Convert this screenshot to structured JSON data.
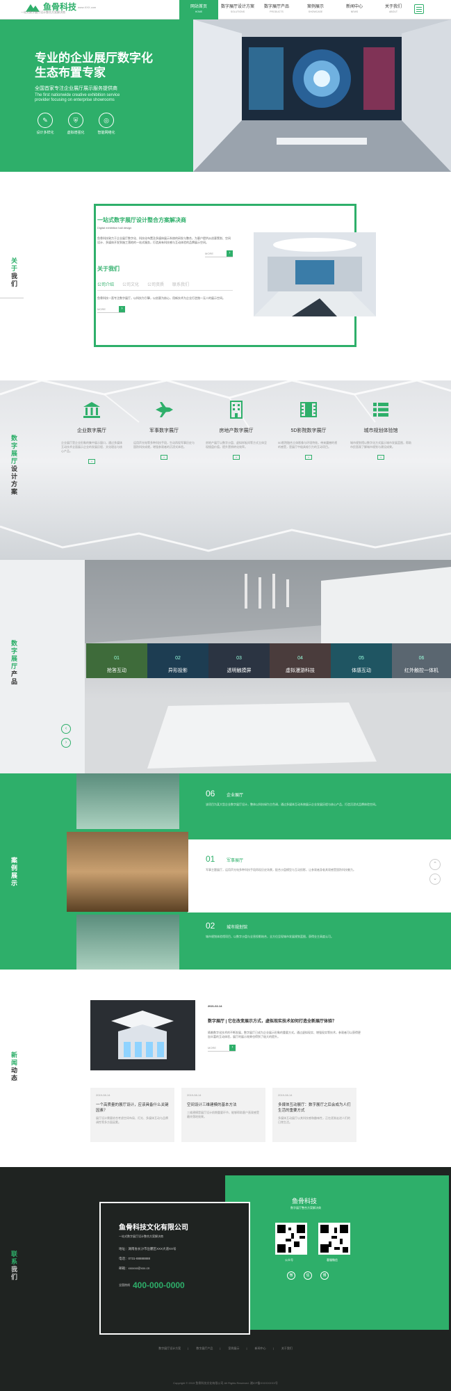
{
  "header": {
    "logo_text": "鱼骨科技",
    "logo_url": "www.XXX.com",
    "logo_tagline": "一站式数字展厅设计整合方案解决商",
    "nav": [
      {
        "cn": "网站首页",
        "en": "HOME"
      },
      {
        "cn": "数字展厅设计方案",
        "en": "SOLUTIONS"
      },
      {
        "cn": "数字展厅产品",
        "en": "PRODUCTS"
      },
      {
        "cn": "案例展示",
        "en": "SHOWCASE"
      },
      {
        "cn": "新闻中心",
        "en": "NEWS"
      },
      {
        "cn": "关于我们",
        "en": "ABOUT"
      }
    ]
  },
  "hero": {
    "title": "专业的企业展厅数字化生态布置专家",
    "subtitle": "全国首家专注企业展厅展示服务提供商",
    "english": "The first nationwide creative exhibition service provider focusing on enterprise showrooms",
    "features": [
      {
        "label": "设计多样化",
        "icon": "design-icon"
      },
      {
        "label": "虚拟增强化",
        "icon": "shield-icon"
      },
      {
        "label": "智能网络化",
        "icon": "globe-icon"
      }
    ]
  },
  "about": {
    "section_label_1": "关于",
    "section_label_2": "我们",
    "heading": "一站式数字展厅设计整合方案解决商",
    "heading_en": "Digital exhibition hall design",
    "paragraph": "鱼骨科技致力于企业展厅数字化、科技化布置及多媒体展示系统的研发与整合，为客户提供从创意策划、空间设计、多媒体开发到施工落地的一站式服务，打造具有科技感与互动体验的品牌展示空间。",
    "more": "MORE",
    "heading2": "关于我们",
    "tabs": [
      "公司介绍",
      "公司文化",
      "公司资质",
      "联系我们"
    ],
    "paragraph2": "鱼骨科技一直专注数字展厅，以科技为引擎，以创意为核心，用新技术为企业打造独一无二的展示空间。"
  },
  "design": {
    "section_label_1": "数字展厅",
    "section_label_2": "设计方案",
    "items": [
      {
        "title": "企业数字展厅",
        "icon": "bank-icon",
        "desc": "企业展厅是企业形象的集中展示窗口，通过多媒体互动技术全面展示企业的发展历程、文化理念与核心产品。"
      },
      {
        "title": "军事数字展厅",
        "icon": "jet-icon",
        "desc": "运用声光电等多种科技手段，生动再现军事历史与国防科技成就，增强参观者的沉浸式体验。"
      },
      {
        "title": "房地产数字展厅",
        "icon": "building-icon",
        "desc": "房地产展厅以数字沙盘、虚拟样板间等方式立体呈现楼盘价值，提升营销转化效率。"
      },
      {
        "title": "5D影院数字展厅",
        "icon": "film-icon",
        "desc": "5D影院融合立体影像与环境特效，带来震撼的视听感受，是展厅中极具吸引力的互动项目。"
      },
      {
        "title": "城市规划体验馆",
        "icon": "list-icon",
        "desc": "城市规划馆以数字化方式展示城市发展蓝图，帮助市民直观了解城市规划与建设成果。"
      }
    ],
    "more": "+"
  },
  "products": {
    "section_label_1": "数字展厅",
    "section_label_2": "产品",
    "cards": [
      {
        "num": "01",
        "label": "抢答互动",
        "color": "#3e6b3a"
      },
      {
        "num": "02",
        "label": "异形投影",
        "color": "#1d3d52"
      },
      {
        "num": "03",
        "label": "透明触摸屏",
        "color": "#2b3442"
      },
      {
        "num": "04",
        "label": "虚拟漫游科技",
        "color": "#4a3c3c"
      },
      {
        "num": "05",
        "label": "体感互动",
        "color": "#1f5562"
      },
      {
        "num": "06",
        "label": "红外触控一体机",
        "color": "#5a6670"
      }
    ],
    "prev": "‹",
    "next": "›"
  },
  "cases": {
    "section_label_1": "案例",
    "section_label_2": "展示",
    "rows": [
      {
        "num": "06",
        "title": "企业展厅",
        "desc": "该项目为某大型企业数字展厅设计，整体以科技绿为主色调，通过多媒体互动系统展示企业发展历程与核心产品，打造沉浸式品牌体验空间。"
      },
      {
        "num": "01",
        "title": "军事展厅",
        "desc": "军事主题展厅，运用声光电多种科技手段再现历史场景，配合沙盘模型与互动投影，让参观者身临其境感受国防科技魅力。"
      },
      {
        "num": "02",
        "title": "城市规划馆",
        "desc": "城市规划体验馆项目，以数字沙盘与全息投影结合，全方位呈现城市发展规划蓝图，获得业主高度认可。"
      }
    ],
    "up": "⌃",
    "down": "⌄"
  },
  "news": {
    "section_label_1": "新闻",
    "section_label_2": "动态",
    "main": {
      "date": "2021-02-14",
      "title": "数字展厅 | 它在改变展示方式，虚拟现实技术如何打造全新展厅体验？",
      "desc": "随着数字化技术的不断发展，数字展厅已成为企业展示形象的重要方式。通过虚拟现实、增强现实等技术，参观者可以获得更加丰富的互动体验，展厅的展示效果也得到了极大的提升。",
      "more": "MORE"
    },
    "cards": [
      {
        "date": "2019-08-14",
        "title": "一个高质量的展厅设计，应该具备什么关键因素？",
        "desc": "展厅设计需要综合考虑空间布局、灯光、多媒体互动与品牌调性等多方面因素。"
      },
      {
        "date": "2019-08-14",
        "title": "空间设计三维建模的基本方法",
        "desc": "三维建模是展厅设计前期重要环节，能够帮助客户直观感受最终落地效果。"
      },
      {
        "date": "2019-08-14",
        "title": "多媒体互动展厅：数字展厅之后会成为人们生活的重要方式",
        "desc": "多媒体互动展厅以其科技感和趣味性，正在逐渐走进人们的日常生活。"
      }
    ]
  },
  "contact": {
    "section_label_1": "联系",
    "section_label_2": "我们",
    "company": "鱼骨科技文化有限公司",
    "company_sub": "一站式数字展厅设计整合方案解决商",
    "address": "地址：湖南省长沙市岳麓区XXX大道XX号",
    "phone_line": "电话：0731-88888888",
    "email": "邮箱：xxxxxx@xxx.cn",
    "hotline_label": "全国热线",
    "hotline": "400-000-0000",
    "brand": "鱼骨科技",
    "brand_sub": "数字展厅整合方案解决商",
    "qr1_label": "公众号",
    "qr2_label": "客服微信",
    "socials": [
      "微",
      "信",
      "博"
    ],
    "footer_links": [
      "数字展厅设计方案",
      "数字展厅产品",
      "案例展示",
      "新闻中心",
      "关于我们"
    ],
    "copyright": "Copyright © 2019 鱼骨科技文化有限公司 All Rights Reserved. 湘ICP备XXXXXXXX号"
  }
}
